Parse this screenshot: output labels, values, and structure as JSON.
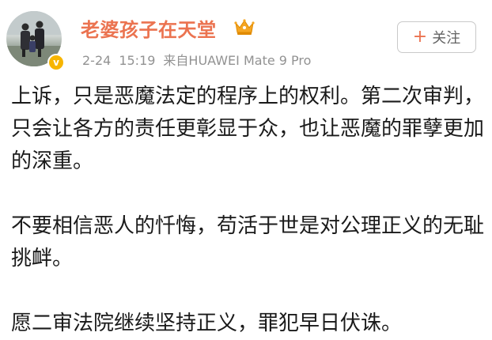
{
  "post": {
    "author": {
      "name": "老婆孩子在天堂",
      "verified_mark": "v",
      "avatar_icon": "family-photo-avatar",
      "member_icon": "crown-icon"
    },
    "meta": {
      "date": "2-24",
      "time": "15:19",
      "source": "来自HUAWEI Mate 9 Pro"
    },
    "follow_button": {
      "plus": "+",
      "label": "关注"
    },
    "paragraphs": [
      "上诉，只是恶魔法定的程序上的权利。第二次审判，只会让各方的责任更彰显于众，也让恶魔的罪孽更加的深重。",
      "不要相信恶人的忏悔，苟活于世是对公理正义的无耻挑衅。",
      "愿二审法院继续坚持正义，罪犯早日伏诛。"
    ]
  },
  "colors": {
    "username": "#eb7350",
    "meta": "#929292",
    "text": "#1a1a1a",
    "badge": "#f7b500"
  }
}
